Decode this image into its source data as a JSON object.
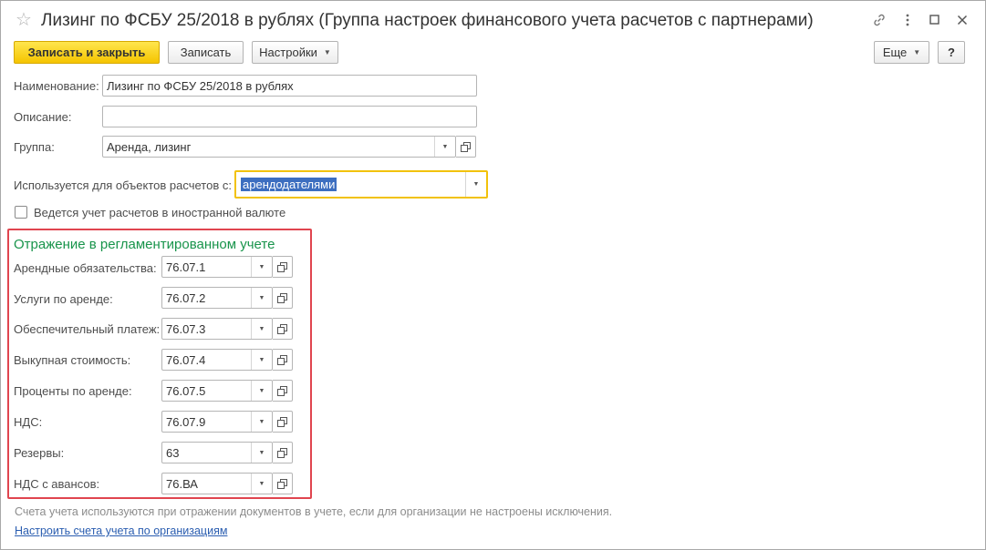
{
  "window": {
    "title": "Лизинг по ФСБУ 25/2018 в рублях (Группа настроек финансового учета расчетов с партнерами)"
  },
  "toolbar": {
    "save_close_label": "Записать и закрыть",
    "save_label": "Записать",
    "settings_label": "Настройки",
    "more_label": "Еще",
    "help_label": "?"
  },
  "form": {
    "name_label": "Наименование:",
    "name_value": "Лизинг по ФСБУ 25/2018 в рублях",
    "description_label": "Описание:",
    "description_value": "",
    "group_label": "Группа:",
    "group_value": "Аренда, лизинг",
    "used_for_label": "Используется для объектов расчетов с:",
    "used_for_value": "арендодателями",
    "currency_checkbox_label": "Ведется учет расчетов в иностранной валюте",
    "currency_checked": false
  },
  "accounting": {
    "title": "Отражение в регламентированном учете",
    "rows": [
      {
        "label": "Арендные обязательства:",
        "value": "76.07.1"
      },
      {
        "label": "Услуги по аренде:",
        "value": "76.07.2"
      },
      {
        "label": "Обеспечительный платеж:",
        "value": "76.07.3"
      },
      {
        "label": "Выкупная стоимость:",
        "value": "76.07.4"
      },
      {
        "label": "Проценты по аренде:",
        "value": "76.07.5"
      },
      {
        "label": "НДС:",
        "value": "76.07.9"
      },
      {
        "label": "Резервы:",
        "value": "63"
      },
      {
        "label": "НДС с авансов:",
        "value": "76.ВА"
      }
    ]
  },
  "footer": {
    "hint": "Счета учета используются при отражении документов в учете, если для организации не настроены исключения.",
    "link": "Настроить счета учета по организациям"
  }
}
